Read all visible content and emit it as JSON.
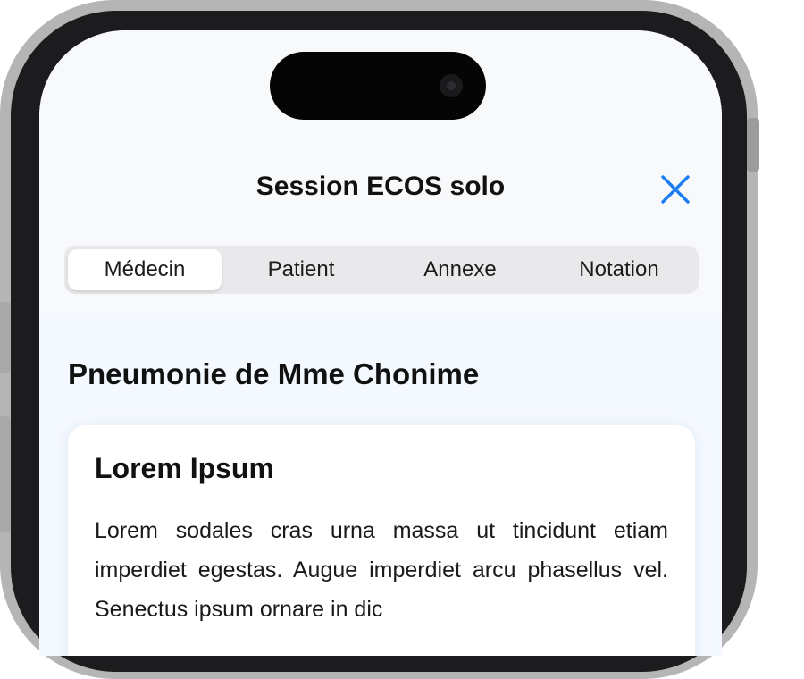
{
  "header": {
    "title": "Session ECOS solo",
    "close_icon": "close-icon"
  },
  "tabs": [
    {
      "label": "Médecin",
      "active": true
    },
    {
      "label": "Patient",
      "active": false
    },
    {
      "label": "Annexe",
      "active": false
    },
    {
      "label": "Notation",
      "active": false
    }
  ],
  "case": {
    "title": "Pneumonie de Mme Chonime"
  },
  "card": {
    "title": "Lorem Ipsum",
    "body": "Lorem sodales cras urna massa ut tincidunt etiam imperdiet egestas. Augue imperdiet arcu phasellus vel. Senectus ipsum ornare in dic"
  },
  "colors": {
    "accent": "#1a7cf0",
    "screen_background": "#f4f8ff",
    "card_background": "#ffffff",
    "segment_background": "#e9e9ec"
  }
}
